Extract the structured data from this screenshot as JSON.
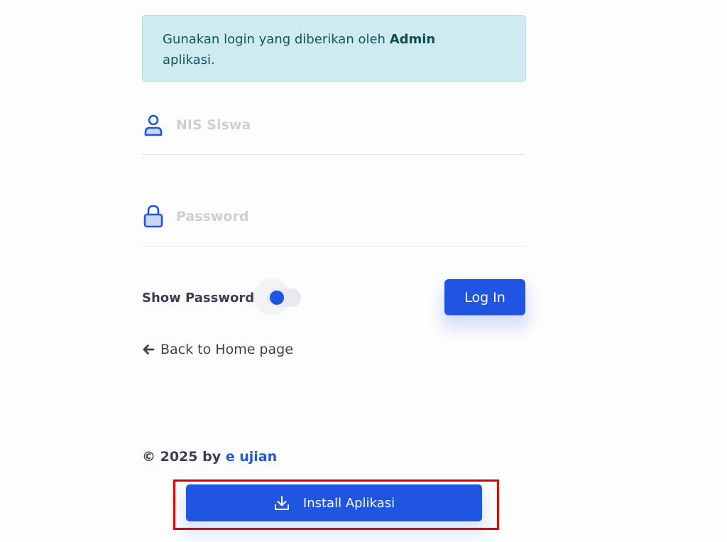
{
  "alert": {
    "text_before": "Gunakan login yang diberikan oleh ",
    "text_bold": "Admin",
    "text_after": " aplikasi."
  },
  "form": {
    "nis": {
      "placeholder": "NIS Siswa",
      "value": "",
      "icon": "user-icon"
    },
    "password": {
      "placeholder": "Password",
      "value": "",
      "icon": "lock-icon"
    },
    "show_password_label": "Show Password",
    "show_password_on": true,
    "login_label": "Log In"
  },
  "back_link": {
    "label": "Back to Home page",
    "icon": "arrow-left-icon"
  },
  "footer": {
    "copyright": "© 2025 by ",
    "brand": "e ujian"
  },
  "install": {
    "label": "Install Aplikasi",
    "icon": "download-icon"
  },
  "colors": {
    "primary": "#1f55e0",
    "alert_bg": "#cfebef",
    "alert_text": "#0d5561",
    "highlight_border": "#e20000"
  }
}
